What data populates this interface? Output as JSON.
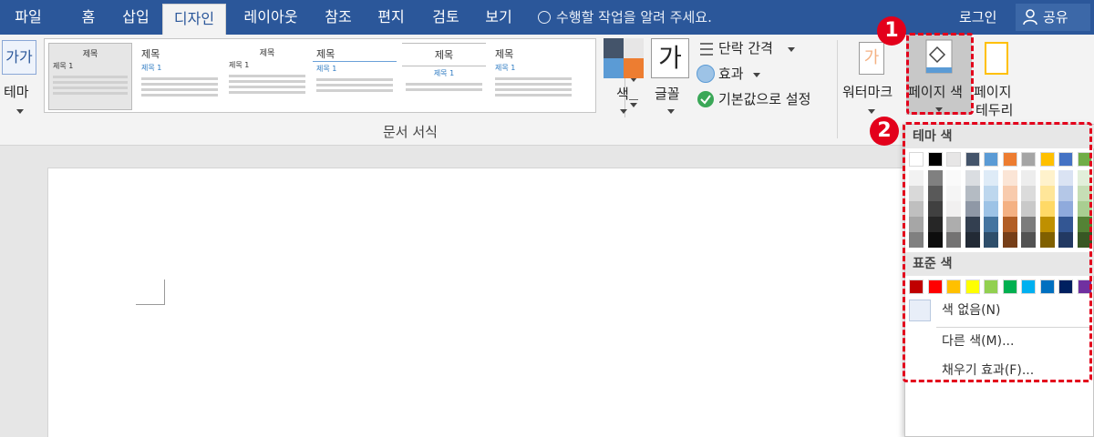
{
  "tabs": [
    {
      "label": "파일",
      "active": false
    },
    {
      "label": "홈",
      "active": false
    },
    {
      "label": "삽입",
      "active": false
    },
    {
      "label": "디자인",
      "active": true
    },
    {
      "label": "레이아웃",
      "active": false
    },
    {
      "label": "참조",
      "active": false
    },
    {
      "label": "편지",
      "active": false
    },
    {
      "label": "검토",
      "active": false
    },
    {
      "label": "보기",
      "active": false
    }
  ],
  "tell_me": "수행할 작업을 알려 주세요.",
  "login": "로그인",
  "share": "공유",
  "ribbon": {
    "theme_label": "테마",
    "theme_icon_text": "가가",
    "gallery": [
      {
        "title": "제목",
        "heading": "제목 1"
      },
      {
        "title": "제목",
        "heading": "제목 1"
      },
      {
        "title": "제목",
        "heading": "제목 1"
      },
      {
        "title": "제목",
        "heading": "제목 1"
      },
      {
        "title": "제목",
        "heading": "제목 1"
      },
      {
        "title": "제목",
        "heading": "제목 1"
      }
    ],
    "colors_label": "색",
    "fonts_label": "글꼴",
    "fonts_icon_text": "가",
    "paragraph_spacing": "단락 간격",
    "effects": "효과",
    "set_default": "기본값으로 설정",
    "group_label": "문서 서식",
    "watermark": "워터마크",
    "watermark_icon_text": "가",
    "page_color": "페이지 색",
    "page_borders_1": "페이지",
    "page_borders_2": "테두리"
  },
  "dropdown": {
    "theme_colors_header": "테마 색",
    "standard_colors_header": "표준 색",
    "theme_colors": [
      "#ffffff",
      "#000000",
      "#e7e6e6",
      "#44546a",
      "#5b9bd5",
      "#ed7d31",
      "#a5a5a5",
      "#ffc000",
      "#4472c4",
      "#70ad47"
    ],
    "standard_colors": [
      "#c00000",
      "#ff0000",
      "#ffc000",
      "#ffff00",
      "#92d050",
      "#00b050",
      "#00b0f0",
      "#0070c0",
      "#002060",
      "#7030a0"
    ],
    "no_color": "색 없음(N)",
    "more_colors": "다른 색(M)...",
    "fill_effects": "채우기 효과(F)..."
  },
  "annotations": [
    {
      "number": "1",
      "color": "#e3001b"
    },
    {
      "number": "2",
      "color": "#e3001b"
    }
  ]
}
